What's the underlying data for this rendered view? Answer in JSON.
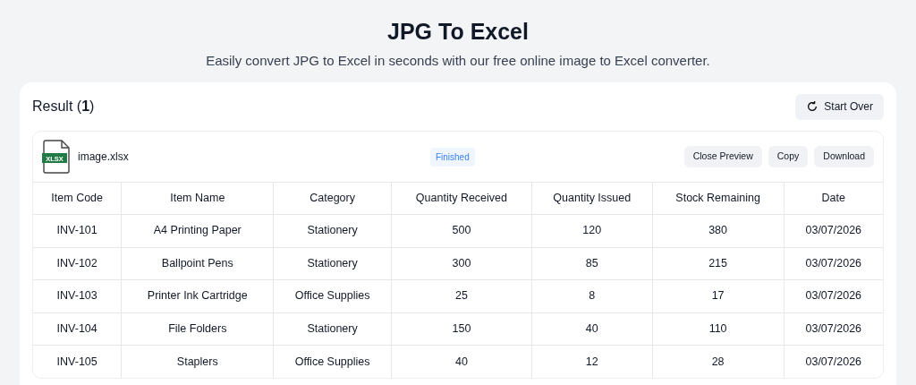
{
  "header": {
    "title": "JPG To Excel",
    "subtitle": "Easily convert JPG to Excel in seconds with our free online image to Excel converter."
  },
  "result": {
    "heading": "Result (**1**)",
    "start_over": "Start Over",
    "file": {
      "icon_label": "XLSX",
      "name": "image.xlsx",
      "status": "Finished",
      "actions": [
        "Close Preview",
        "Copy",
        "Download"
      ]
    },
    "table": {
      "columns": [
        "Item Code",
        "Item Name",
        "Category",
        "Quantity Received",
        "Quantity Issued",
        "Stock Remaining",
        "Date"
      ],
      "rows": [
        [
          "INV-101",
          "A4 Printing Paper",
          "Stationery",
          "500",
          "120",
          "380",
          "03/07/2026"
        ],
        [
          "INV-102",
          "Ballpoint Pens",
          "Stationery",
          "300",
          "85",
          "215",
          "03/07/2026"
        ],
        [
          "INV-103",
          "Printer Ink Cartridge",
          "Office Supplies",
          "25",
          "8",
          "17",
          "03/07/2026"
        ],
        [
          "INV-104",
          "File Folders",
          "Stationery",
          "150",
          "40",
          "110",
          "03/07/2026"
        ],
        [
          "INV-105",
          "Staplers",
          "Office Supplies",
          "40",
          "12",
          "28",
          "03/07/2026"
        ]
      ]
    }
  }
}
